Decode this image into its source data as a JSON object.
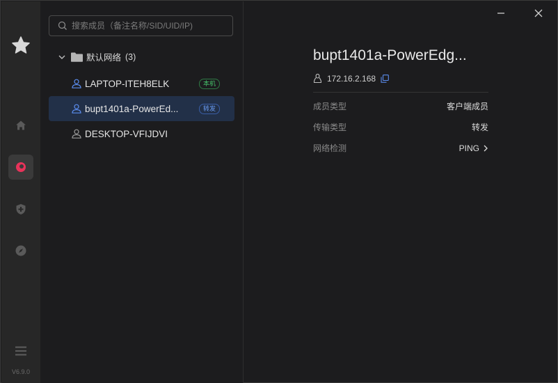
{
  "rail": {
    "version": "V6.9.0",
    "icons": [
      "star-logo-icon",
      "home-icon",
      "network-icon",
      "shield-plus-icon",
      "compass-icon",
      "menu-icon"
    ],
    "accent": "#e8335a"
  },
  "search": {
    "placeholder": "搜索成员（备注名称/SID/UID/IP)",
    "value": ""
  },
  "network": {
    "name": "默认网络",
    "count": "(3)"
  },
  "members": [
    {
      "name": "LAPTOP-ITEH8ELK",
      "badge": "本机",
      "icon_color": "#5b8def"
    },
    {
      "name": "bupt1401a-PowerEd...",
      "badge": "转发",
      "icon_color": "#5b8def",
      "selected": true
    },
    {
      "name": "DESKTOP-VFIJDVI",
      "badge": "",
      "icon_color": "#9a9a9a"
    }
  ],
  "detail": {
    "title": "bupt1401a-PowerEdg...",
    "ip": "172.16.2.168",
    "rows": [
      {
        "label": "成员类型",
        "value": "客户端成员"
      },
      {
        "label": "传输类型",
        "value": "转发"
      },
      {
        "label": "网络检测",
        "value": "PING"
      }
    ]
  },
  "window": {
    "minimize": "minimize-icon",
    "close": "close-icon"
  }
}
